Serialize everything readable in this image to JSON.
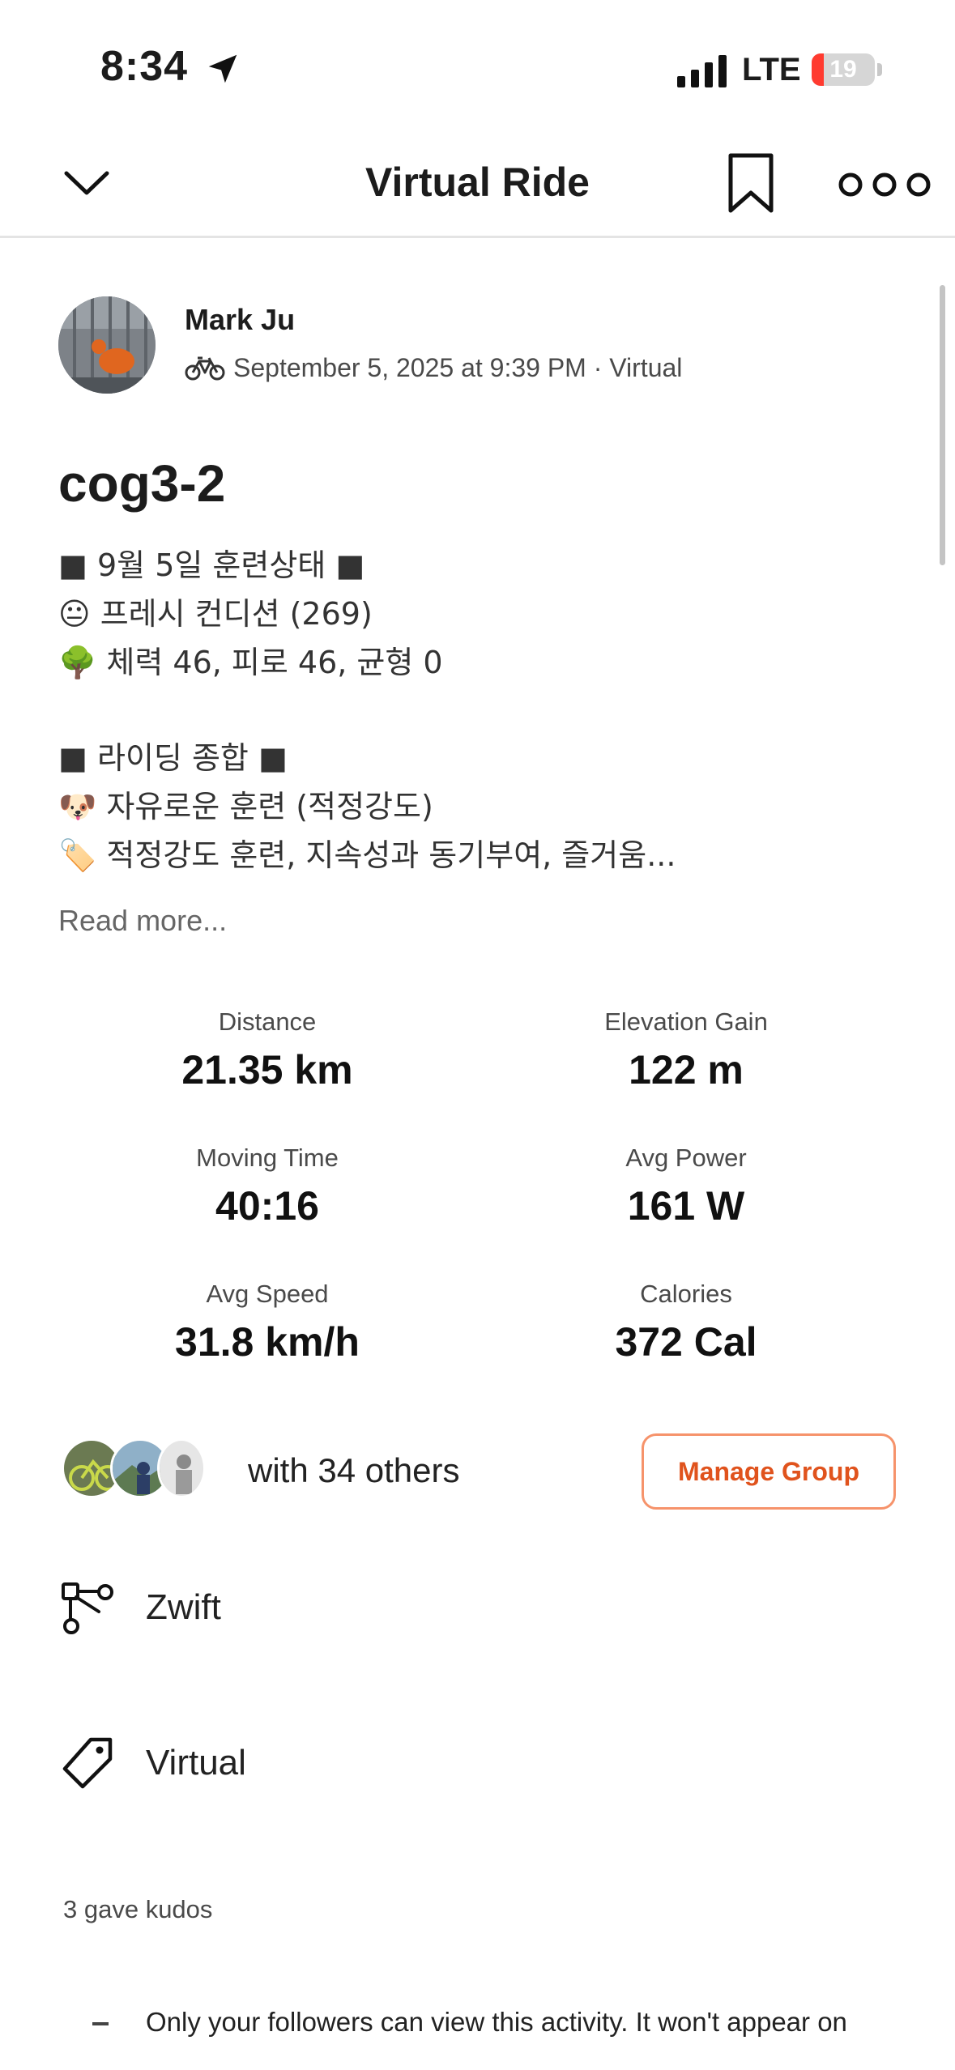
{
  "status_bar": {
    "time": "8:34",
    "network": "LTE",
    "battery_level": "19",
    "battery_fraction": 0.19,
    "location_icon": "location-arrow-icon",
    "signal_icon": "cellular-signal-icon"
  },
  "header": {
    "title": "Virtual Ride",
    "back_icon": "chevron-down-icon",
    "bookmark_icon": "bookmark-icon",
    "more_icon": "more-horizontal-icon"
  },
  "athlete": {
    "name": "Mark Ju",
    "activity_icon": "bike-icon",
    "meta": "September 5, 2025 at 9:39 PM · Virtual"
  },
  "activity": {
    "title": "cog3-2",
    "description_lines": [
      "■ 9월 5일 훈련상태 ■",
      "😐 프레시 컨디션 (269)",
      "🌳 체력 46, 피로 46, 균형 0",
      "",
      "■ 라이딩 종합 ■",
      "🐶 자유로운 훈련 (적정강도)",
      "🏷️ 적정강도 훈련, 지속성과 동기부여, 즐거움..."
    ],
    "read_more": "Read more..."
  },
  "stats": [
    {
      "label": "Distance",
      "value": "21.35 km"
    },
    {
      "label": "Elevation Gain",
      "value": "122 m"
    },
    {
      "label": "Moving Time",
      "value": "40:16"
    },
    {
      "label": "Avg Power",
      "value": "161 W"
    },
    {
      "label": "Avg Speed",
      "value": "31.8 km/h"
    },
    {
      "label": "Calories",
      "value": "372 Cal"
    }
  ],
  "group": {
    "text": "with 34 others",
    "button": "Manage Group"
  },
  "rows": [
    {
      "icon": "device-network-icon",
      "label": "Zwift"
    },
    {
      "icon": "tag-icon",
      "label": "Virtual"
    }
  ],
  "kudos": "3 gave kudos",
  "privacy_text": "Only your followers can view this activity. It won't appear on",
  "colors": {
    "accent": "#e0531d",
    "accent_border": "#f6936b",
    "battery_low": "#ff3b30"
  }
}
